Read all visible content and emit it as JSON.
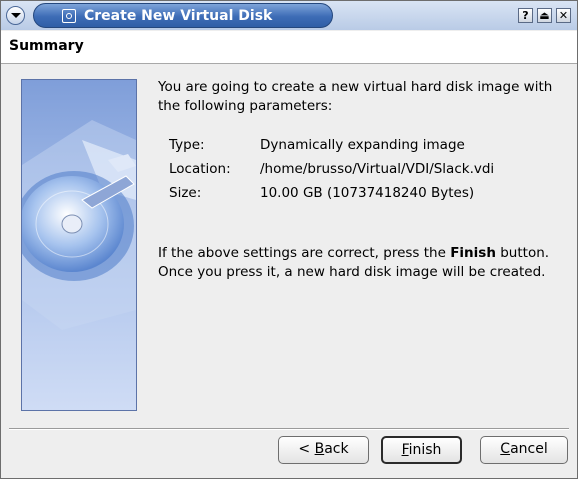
{
  "window": {
    "title": "Create New Virtual Disk",
    "controls": {
      "help": "?",
      "shade": "⏏",
      "close": "✕"
    }
  },
  "header": {
    "title": "Summary"
  },
  "illustration": {
    "icon": "hard-disk-image",
    "colors": {
      "top": "#7f9ed9",
      "bottom": "#cfdcf5"
    }
  },
  "summary": {
    "intro": "You are going to create a new virtual hard disk image with the following parameters:",
    "params": [
      {
        "label": "Type:",
        "value": "Dynamically expanding image"
      },
      {
        "label": "Location:",
        "value": "/home/brusso/Virtual/VDI/Slack.vdi"
      },
      {
        "label": "Size:",
        "value": "10.00 GB (10737418240 Bytes)"
      }
    ],
    "note_prefix": "If the above settings are correct, press the ",
    "note_bold": "Finish",
    "note_suffix": " button. Once you press it, a new hard disk image will be created."
  },
  "buttons": {
    "back": {
      "prefix": "< ",
      "mnemonic": "B",
      "rest": "ack"
    },
    "finish": {
      "mnemonic": "F",
      "rest": "inish"
    },
    "cancel": {
      "mnemonic": "C",
      "rest": "ancel"
    }
  },
  "colors": {
    "title_accent": "#3d6cb6",
    "window_bg": "#eeeeee"
  }
}
